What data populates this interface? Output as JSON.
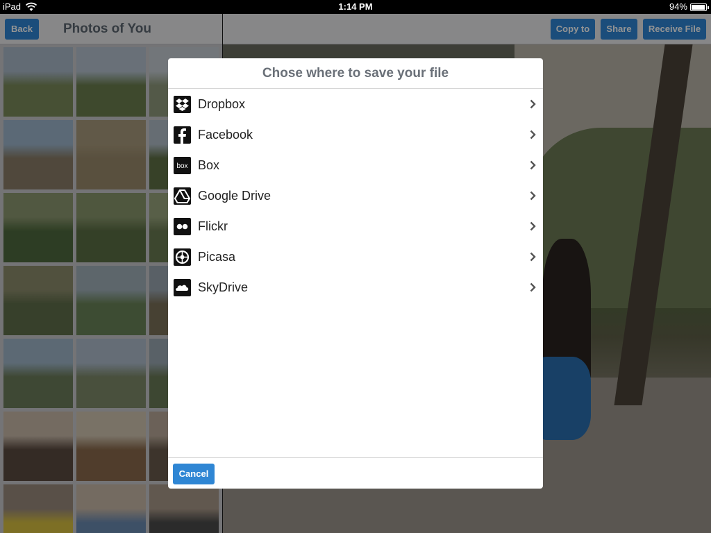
{
  "status_bar": {
    "carrier": "iPad",
    "time": "1:14 PM",
    "battery": "94%",
    "icons": [
      "wifi-icon",
      "battery-icon"
    ]
  },
  "left_panel": {
    "back_label": "Back",
    "title": "Photos of You",
    "thumbnail_count": 21
  },
  "right_panel": {
    "buttons": {
      "copy_to": "Copy to",
      "share": "Share",
      "receive_file": "Receive File"
    }
  },
  "dialog": {
    "title": "Chose where to save your file",
    "services": [
      {
        "label": "Dropbox",
        "icon": "dropbox-icon"
      },
      {
        "label": "Facebook",
        "icon": "facebook-icon"
      },
      {
        "label": "Box",
        "icon": "box-icon"
      },
      {
        "label": "Google Drive",
        "icon": "google-drive-icon"
      },
      {
        "label": "Flickr",
        "icon": "flickr-icon"
      },
      {
        "label": "Picasa",
        "icon": "picasa-icon"
      },
      {
        "label": "SkyDrive",
        "icon": "skydrive-icon"
      }
    ],
    "cancel_label": "Cancel"
  },
  "colors": {
    "accent": "#2f86d4",
    "nav_bg": "#e9e9ea",
    "title_gray": "#6a7078"
  }
}
